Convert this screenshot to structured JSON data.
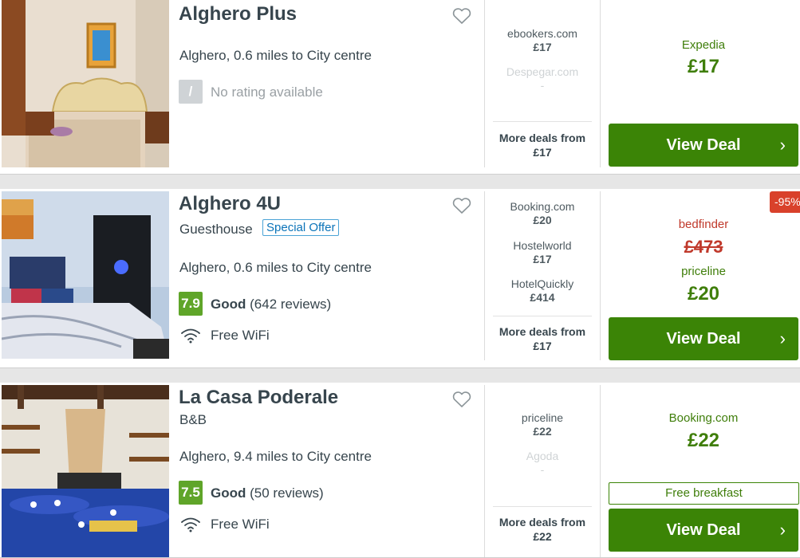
{
  "colors": {
    "accent_green": "#3b8406",
    "rating_green": "#5fa529",
    "strike_red": "#c0392b",
    "link_blue": "#0a73b8"
  },
  "listings": [
    {
      "name": "Alghero Plus",
      "location": "Alghero, 0.6 miles to City centre",
      "rating_icon": "/",
      "rating_text": "No rating available",
      "deals": [
        {
          "provider": "ebookers.com",
          "price": "£17"
        },
        {
          "provider": "Despegar.com",
          "price": "-"
        }
      ],
      "more_label": "More deals from",
      "more_price": "£17",
      "best_provider": "Expedia",
      "best_price": "£17",
      "button_label": "View Deal",
      "favorite_icon": "heart-outline-icon"
    },
    {
      "name": "Alghero 4U",
      "type": "Guesthouse",
      "badge": "Special Offer",
      "location": "Alghero, 0.6 miles to City centre",
      "rating": "7.9",
      "rating_word": "Good",
      "reviews": "(642 reviews)",
      "amenity": "Free WiFi",
      "deals": [
        {
          "provider": "Booking.com",
          "price": "£20"
        },
        {
          "provider": "Hostelworld",
          "price": "£17"
        },
        {
          "provider": "HotelQuickly",
          "price": "£414"
        }
      ],
      "more_label": "More deals from",
      "more_price": "£17",
      "discount": "-95%",
      "strike_provider": "bedfinder",
      "strike_price": "£473",
      "best_provider": "priceline",
      "best_price": "£20",
      "button_label": "View Deal",
      "favorite_icon": "heart-outline-icon"
    },
    {
      "name": "La Casa Poderale",
      "type": "B&B",
      "location": "Alghero, 9.4 miles to City centre",
      "rating": "7.5",
      "rating_word": "Good",
      "reviews": "(50 reviews)",
      "amenity": "Free WiFi",
      "deals": [
        {
          "provider": "priceline",
          "price": "£22"
        },
        {
          "provider": "Agoda",
          "price": "-"
        }
      ],
      "more_label": "More deals from",
      "more_price": "£22",
      "best_provider": "Booking.com",
      "best_price": "£22",
      "perk": "Free breakfast",
      "button_label": "View Deal",
      "favorite_icon": "heart-outline-icon"
    }
  ]
}
